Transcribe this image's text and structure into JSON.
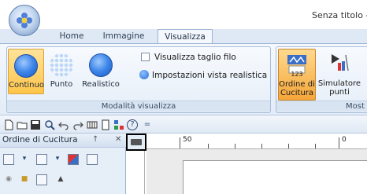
{
  "window": {
    "title": "Senza titolo -"
  },
  "tabs": [
    {
      "label": "Home"
    },
    {
      "label": "Immagine"
    },
    {
      "label": "Visualizza",
      "active": true
    }
  ],
  "ribbon": {
    "visualization_group": {
      "label": "Modalità visualizza",
      "buttons": [
        {
          "label": "Continuo",
          "icon": "continuous-view-icon",
          "selected": true
        },
        {
          "label": "Punto",
          "icon": "stitch-point-view-icon"
        },
        {
          "label": "Realistico",
          "icon": "realistic-view-icon"
        }
      ],
      "checkbox_label": "Visualizza taglio filo",
      "checkbox_checked": false,
      "realistic_settings_label": "Impostazioni vista realistica"
    },
    "show_group": {
      "label": "Most",
      "buttons": [
        {
          "label_line1": "Ordine di",
          "label_line2": "Cucitura",
          "badge": "123",
          "icon": "sewing-order-icon",
          "selected": true
        },
        {
          "label_line1": "Simulatore",
          "label_line2": "punti",
          "icon": "stitch-simulator-icon"
        }
      ]
    }
  },
  "quick_access": {
    "icons": [
      "new-file-icon",
      "open-file-icon",
      "save-icon",
      "zoom-icon",
      "undo-icon",
      "redo-icon",
      "grid-icon",
      "page-icon",
      "layout-icon",
      "help-icon",
      "customize-icon"
    ],
    "help_glyph": "?",
    "customize_glyph": "="
  },
  "pane": {
    "title": "Ordine di Cucitura",
    "pin_glyph": "↑",
    "close_glyph": "✕"
  },
  "ruler": {
    "labels": [
      "50",
      "0"
    ]
  }
}
